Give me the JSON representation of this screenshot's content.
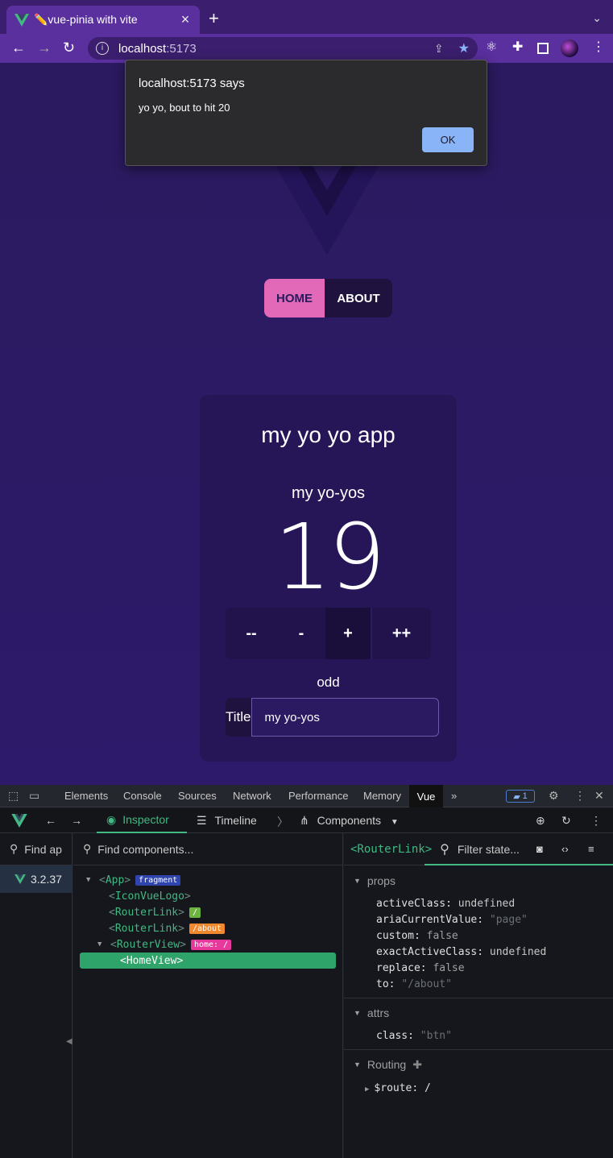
{
  "browser": {
    "tab_title": "✏️vue-pinia with vite",
    "tab_close": "×",
    "new_tab": "+",
    "tab_list": "⌄",
    "url_host": "localhost",
    "url_port": ":5173",
    "back": "←",
    "forward": "→",
    "reload": "↻"
  },
  "alert": {
    "title": "localhost:5173 says",
    "message": "yo yo, bout to hit 20",
    "ok": "OK"
  },
  "page": {
    "nav": {
      "home": "HOME",
      "about": "ABOUT"
    },
    "app_title": "my yo yo app",
    "counter_title": "my yo-yos",
    "counter": "19",
    "buttons": {
      "dec2": "--",
      "dec1": "-",
      "inc1": "+",
      "inc2": "++"
    },
    "odd_even": "odd",
    "title_label": "Title",
    "title_value": "my yo-yos"
  },
  "devtools": {
    "tabs": [
      "Elements",
      "Console",
      "Sources",
      "Network",
      "Performance",
      "Memory"
    ],
    "active_tab": "Vue",
    "more": "»",
    "issues_count": "1",
    "vue_bar": {
      "inspector": "Inspector",
      "timeline": "Timeline",
      "components": "Components"
    },
    "find_apps": "Find ap",
    "app_version": "3.2.37",
    "find_components": "Find components...",
    "tree": [
      {
        "name": "App",
        "tag": "fragment"
      },
      {
        "name": "IconVueLogo"
      },
      {
        "name": "RouterLink",
        "tag": "/"
      },
      {
        "name": "RouterLink",
        "tag": "/about"
      },
      {
        "name": "RouterView",
        "tag": "home: /"
      },
      {
        "name": "HomeView"
      }
    ],
    "selected_component": "<RouterLink>",
    "filter_state": "Filter state...",
    "sections": {
      "props": "props",
      "attrs": "attrs",
      "routing": "Routing"
    },
    "props": [
      {
        "key": "activeClass:",
        "value": "undefined",
        "kind": "undef"
      },
      {
        "key": "ariaCurrentValue:",
        "value": "\"page\"",
        "kind": "str"
      },
      {
        "key": "custom:",
        "value": "false",
        "kind": "bool"
      },
      {
        "key": "exactActiveClass:",
        "value": "undefined",
        "kind": "undef"
      },
      {
        "key": "replace:",
        "value": "false",
        "kind": "bool"
      },
      {
        "key": "to:",
        "value": "\"/about\"",
        "kind": "str"
      }
    ],
    "attrs": [
      {
        "key": "class:",
        "value": "\"btn\"",
        "kind": "str"
      }
    ],
    "routing": {
      "key": "$route:",
      "value": "/"
    }
  },
  "colors": {
    "page_bg": "#2b1a5f",
    "accent_pink": "#e268b8",
    "vue_green": "#42b883",
    "alert_button": "#8ab4f8"
  }
}
